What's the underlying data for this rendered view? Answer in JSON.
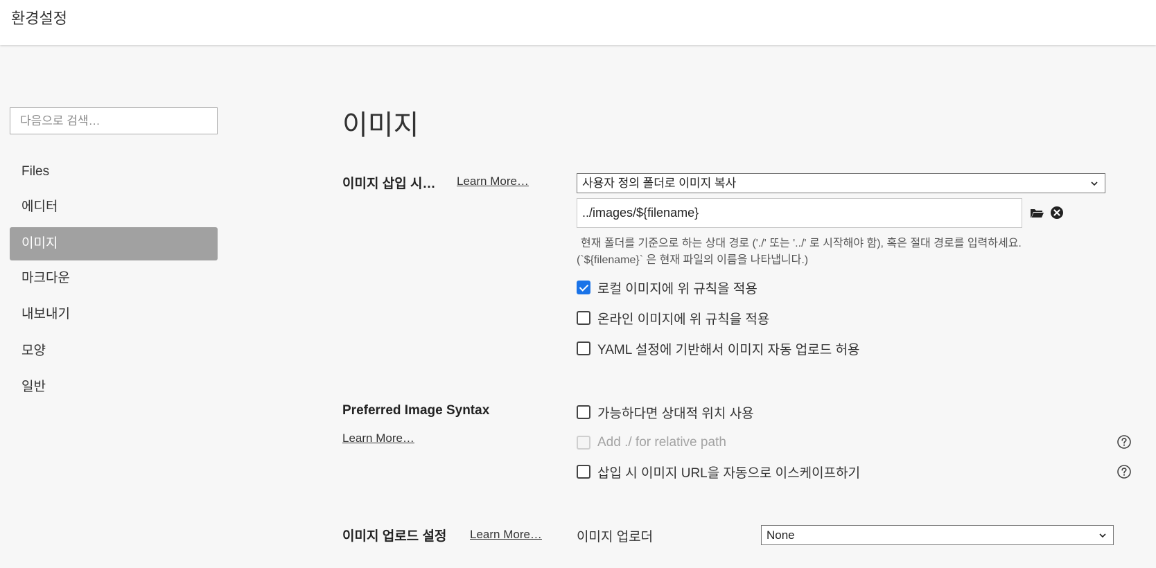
{
  "window": {
    "title": "환경설정"
  },
  "sidebar": {
    "search_placeholder": "다음으로 검색…",
    "items": [
      {
        "label": "Files",
        "active": false
      },
      {
        "label": "에디터",
        "active": false
      },
      {
        "label": "이미지",
        "active": true
      },
      {
        "label": "마크다운",
        "active": false
      },
      {
        "label": "내보내기",
        "active": false
      },
      {
        "label": "모양",
        "active": false
      },
      {
        "label": "일반",
        "active": false
      }
    ]
  },
  "main": {
    "title": "이미지",
    "insert": {
      "label": "이미지 삽입 시…",
      "learn_more": "Learn More…",
      "action_selected": "사용자 정의 폴더로 이미지 복사",
      "path_value": "../images/${filename}",
      "hint_line1": "현재 폴더를 기준으로 하는 상대 경로 ('./' 또는 '../' 로 시작해야 함), 혹은 절대 경로를 입력하세요.",
      "hint_line2": "(`${filename}` 은 현재 파일의 이름을 나타냅니다.)",
      "folder_icon": "folder-icon",
      "clear_icon": "clear-icon",
      "options": [
        {
          "label": "로컬 이미지에 위 규칙을 적용",
          "checked": true,
          "disabled": false
        },
        {
          "label": "온라인 이미지에 위 규칙을 적용",
          "checked": false,
          "disabled": false
        },
        {
          "label": "YAML 설정에 기반해서 이미지 자동 업로드 허용",
          "checked": false,
          "disabled": false
        }
      ]
    },
    "syntax": {
      "label": "Preferred Image Syntax",
      "learn_more": "Learn More…",
      "options": [
        {
          "label": "가능하다면 상대적 위치 사용",
          "checked": false,
          "disabled": false
        },
        {
          "label": "Add ./ for relative path",
          "checked": false,
          "disabled": true
        },
        {
          "label": "삽입 시 이미지 URL을 자동으로 이스케이프하기",
          "checked": false,
          "disabled": false
        }
      ]
    },
    "upload": {
      "label": "이미지 업로드 설정",
      "learn_more": "Learn More…",
      "uploader_label": "이미지 업로더",
      "uploader_selected": "None"
    }
  },
  "colors": {
    "accent": "#1a73e8",
    "active_nav_bg": "#a1a1a1",
    "background": "#f7f7f7"
  }
}
